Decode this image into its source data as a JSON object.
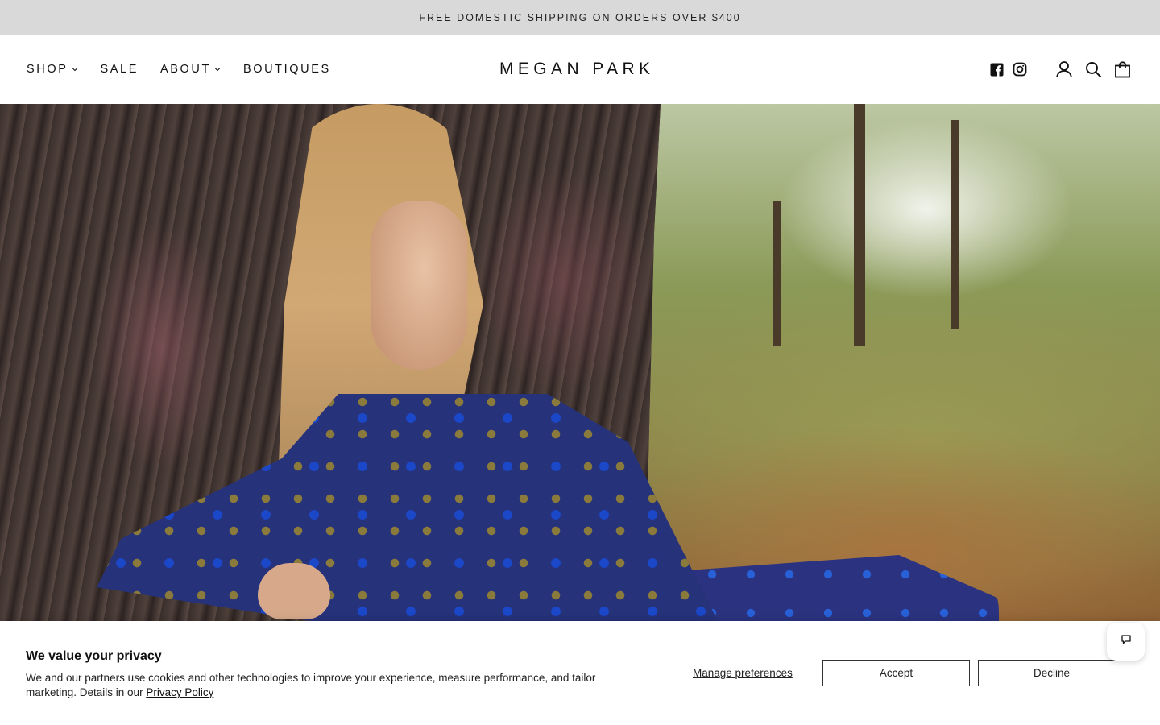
{
  "announcement": {
    "text": "FREE DOMESTIC SHIPPING ON ORDERS OVER $400"
  },
  "header": {
    "logo": "MEGAN PARK",
    "nav": [
      {
        "label": "SHOP",
        "has_dropdown": true
      },
      {
        "label": "SALE",
        "has_dropdown": false
      },
      {
        "label": "ABOUT",
        "has_dropdown": true
      },
      {
        "label": "BOUTIQUES",
        "has_dropdown": false
      }
    ],
    "icons": [
      "facebook-icon",
      "instagram-icon",
      "account-icon",
      "search-icon",
      "cart-icon"
    ]
  },
  "hero": {
    "image": "woman-in-blue-paisley-dress-leaning-on-pine-tree"
  },
  "cookie": {
    "title": "We value your privacy",
    "body": "We and our partners use cookies and other technologies to improve your experience, measure performance, and tailor marketing. Details in our",
    "policy_link": "Privacy Policy",
    "manage": "Manage preferences",
    "accept": "Accept",
    "decline": "Decline"
  },
  "chat": {
    "icon": "chat-bubble-icon"
  },
  "colors": {
    "announcement_bg": "#d9d9d9",
    "text": "#111111",
    "border": "#333333"
  }
}
